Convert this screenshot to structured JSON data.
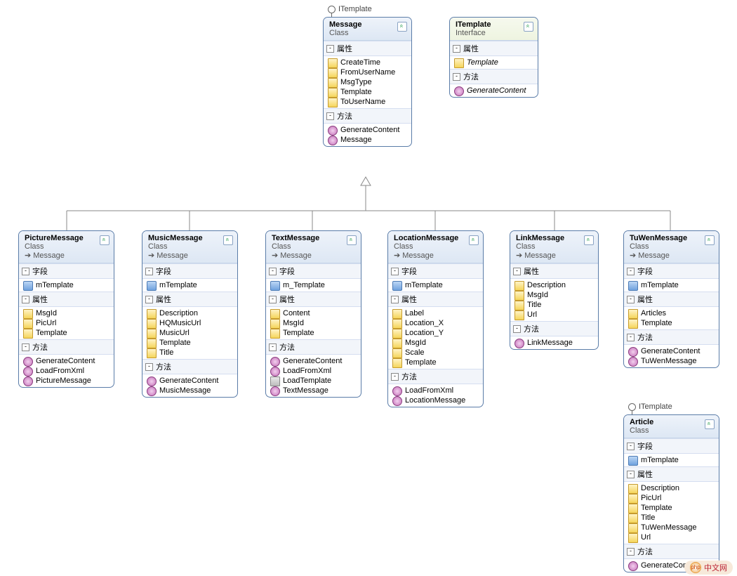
{
  "sections": {
    "fields": "字段",
    "props": "属性",
    "methods": "方法"
  },
  "lollipop_label": "ITemplate",
  "watermark": "中文网",
  "watermark_logo": "php",
  "message": {
    "name": "Message",
    "type": "Class",
    "props": [
      "CreateTime",
      "FromUserName",
      "MsgType",
      "Template",
      "ToUserName"
    ],
    "methods": [
      "GenerateContent",
      "Message"
    ]
  },
  "itemplate": {
    "name": "ITemplate",
    "type": "Interface",
    "props": [
      "Template"
    ],
    "methods": [
      "GenerateContent"
    ]
  },
  "picture": {
    "name": "PictureMessage",
    "type": "Class",
    "inherits": "Message",
    "fields": [
      "mTemplate"
    ],
    "props": [
      "MsgId",
      "PicUrl",
      "Template"
    ],
    "methods": [
      "GenerateContent",
      "LoadFromXml",
      "PictureMessage"
    ]
  },
  "music": {
    "name": "MusicMessage",
    "type": "Class",
    "inherits": "Message",
    "fields": [
      "mTemplate"
    ],
    "props": [
      "Description",
      "HQMusicUrl",
      "MusicUrl",
      "Template",
      "Title"
    ],
    "methods": [
      "GenerateContent",
      "MusicMessage"
    ]
  },
  "text": {
    "name": "TextMessage",
    "type": "Class",
    "inherits": "Message",
    "fields": [
      "m_Template"
    ],
    "props": [
      "Content",
      "MsgId",
      "Template"
    ],
    "methods": [
      "GenerateContent",
      "LoadFromXml",
      "LoadTemplate",
      "TextMessage"
    ],
    "method_priv": [
      false,
      false,
      true,
      false
    ]
  },
  "location": {
    "name": "LocationMessage",
    "type": "Class",
    "inherits": "Message",
    "fields": [
      "mTemplate"
    ],
    "props": [
      "Label",
      "Location_X",
      "Location_Y",
      "MsgId",
      "Scale",
      "Template"
    ],
    "methods": [
      "LoadFromXml",
      "LocationMessage"
    ]
  },
  "link": {
    "name": "LinkMessage",
    "type": "Class",
    "inherits": "Message",
    "props": [
      "Description",
      "MsgId",
      "Title",
      "Url"
    ],
    "methods": [
      "LinkMessage"
    ]
  },
  "tuwen": {
    "name": "TuWenMessage",
    "type": "Class",
    "inherits": "Message",
    "fields": [
      "mTemplate"
    ],
    "props": [
      "Articles",
      "Template"
    ],
    "methods": [
      "GenerateContent",
      "TuWenMessage"
    ]
  },
  "article": {
    "name": "Article",
    "type": "Class",
    "fields": [
      "mTemplate"
    ],
    "props": [
      "Description",
      "PicUrl",
      "Template",
      "Title",
      "TuWenMessage",
      "Url"
    ],
    "methods": [
      "GenerateContent"
    ]
  }
}
